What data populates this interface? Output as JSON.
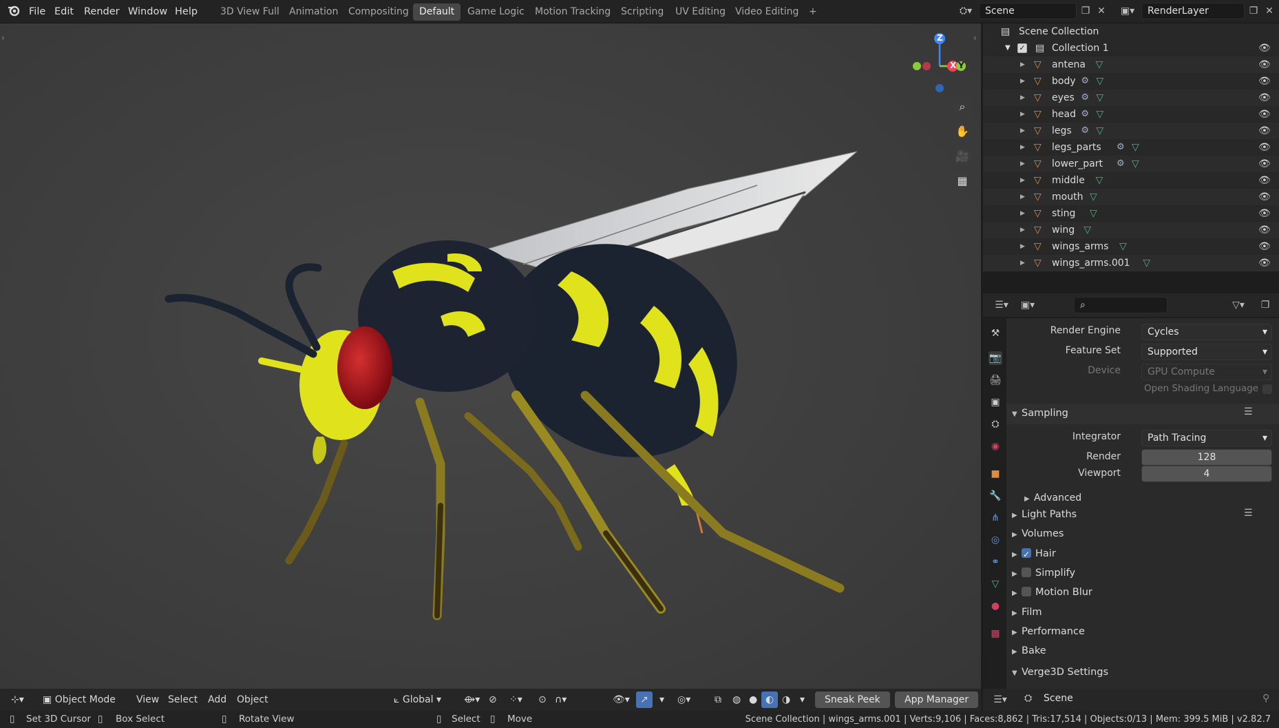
{
  "topbar": {
    "menus": [
      "File",
      "Edit",
      "Render",
      "Window",
      "Help"
    ],
    "workspaces": [
      "3D View Full",
      "Animation",
      "Compositing",
      "Default",
      "Game Logic",
      "Motion Tracking",
      "Scripting",
      "UV Editing",
      "Video Editing"
    ],
    "active_workspace": "Default",
    "add_tab": "+",
    "scene": "Scene",
    "view_layer": "RenderLayer"
  },
  "viewport": {
    "axes": {
      "z": "Z",
      "x": "X",
      "y": "Y"
    },
    "header": {
      "mode": "Object Mode",
      "menus": [
        "View",
        "Select",
        "Add",
        "Object"
      ],
      "orientation": "Global",
      "sneak_peek": "Sneak Peek",
      "app_manager": "App Manager"
    }
  },
  "outliner": {
    "root": "Scene Collection",
    "collection": "Collection 1",
    "objects": [
      {
        "name": "antena",
        "modifier": false
      },
      {
        "name": "body",
        "modifier": true
      },
      {
        "name": "eyes",
        "modifier": true
      },
      {
        "name": "head",
        "modifier": true
      },
      {
        "name": "legs",
        "modifier": true
      },
      {
        "name": "legs_parts",
        "modifier": true
      },
      {
        "name": "lower_part",
        "modifier": true
      },
      {
        "name": "middle",
        "modifier": false
      },
      {
        "name": "mouth",
        "modifier": false
      },
      {
        "name": "sting",
        "modifier": false
      },
      {
        "name": "wing",
        "modifier": false
      },
      {
        "name": "wings_arms",
        "modifier": false
      },
      {
        "name": "wings_arms.001",
        "modifier": false
      }
    ]
  },
  "properties": {
    "render_engine_label": "Render Engine",
    "render_engine": "Cycles",
    "feature_set_label": "Feature Set",
    "feature_set": "Supported",
    "device_label": "Device",
    "device": "GPU Compute",
    "osl_label": "Open Shading Language",
    "sampling": "Sampling",
    "integrator_label": "Integrator",
    "integrator": "Path Tracing",
    "render_label": "Render",
    "render_samples": "128",
    "viewport_label": "Viewport",
    "viewport_samples": "4",
    "advanced": "Advanced",
    "panels": [
      {
        "label": "Light Paths",
        "checkbox": null
      },
      {
        "label": "Volumes",
        "checkbox": null
      },
      {
        "label": "Hair",
        "checkbox": true
      },
      {
        "label": "Simplify",
        "checkbox": false
      },
      {
        "label": "Motion Blur",
        "checkbox": false
      },
      {
        "label": "Film",
        "checkbox": null
      },
      {
        "label": "Performance",
        "checkbox": null
      },
      {
        "label": "Bake",
        "checkbox": null
      }
    ],
    "verge3d": "Verge3D Settings",
    "footer_scene": "Scene"
  },
  "statusbar": {
    "set_cursor": "Set 3D Cursor",
    "box_select": "Box Select",
    "rotate_view": "Rotate View",
    "select": "Select",
    "move": "Move",
    "stats": "Scene Collection | wings_arms.001 | Verts:9,106 | Faces:8,862 | Tris:17,514 | Objects:0/13 | Mem: 399.5 MiB | v2.82.7"
  },
  "colors": {
    "accent": "#4772b3",
    "wasp_yellow": "#e0e21c",
    "wasp_black": "#1b2230",
    "eye_red": "#a8101a",
    "mesh_icon": "#e08a3c",
    "data_icon": "#3fb980"
  }
}
